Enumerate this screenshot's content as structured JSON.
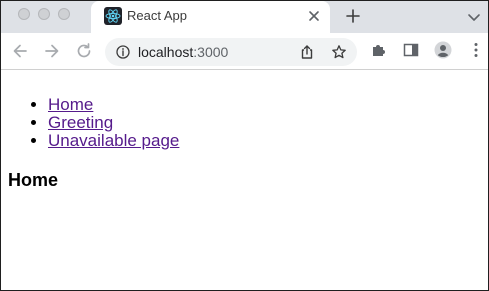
{
  "browser": {
    "tab": {
      "title": "React App",
      "favicon": "react-logo-icon"
    },
    "address_bar": {
      "host": "localhost",
      "port": ":3000"
    },
    "icons": {
      "back": "arrow-left-icon",
      "forward": "arrow-right-icon",
      "reload": "reload-icon",
      "info": "info-icon",
      "share": "share-icon",
      "bookmark": "star-icon",
      "extensions": "puzzle-icon",
      "sidepanel": "side-panel-icon",
      "profile": "profile-icon",
      "menu": "kebab-menu-icon",
      "new_tab": "plus-icon",
      "tab_search": "chevron-down-icon",
      "close_tab": "close-icon"
    }
  },
  "page": {
    "nav": [
      {
        "label": "Home"
      },
      {
        "label": "Greeting"
      },
      {
        "label": "Unavailable page"
      }
    ],
    "heading": "Home"
  }
}
